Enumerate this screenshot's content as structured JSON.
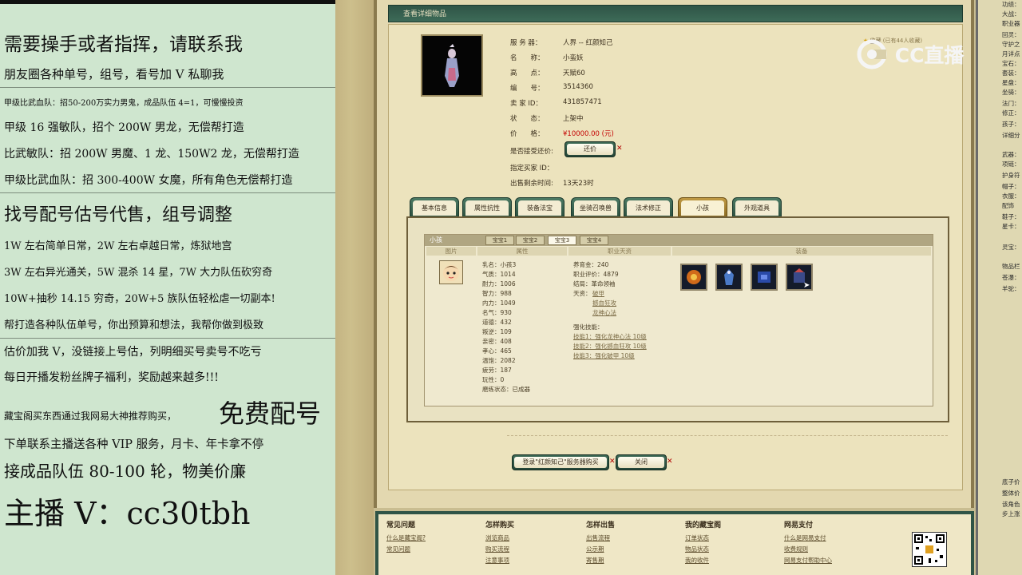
{
  "left_panel": {
    "lines": [
      "需要操手或者指挥，请联系我",
      "朋友圈各种单号，组号，看号加 V 私聊我",
      "甲级比武血队：招50-200万实力男鬼，成品队伍 4=1，可慢慢投资",
      "甲级 16 强敏队，招个 200W 男龙，无偿帮打造",
      "比武敏队：招 200W 男魔、1 龙、150W2 龙，无偿帮打造",
      "甲级比武血队：招 300-400W 女魔，所有角色无偿帮打造",
      "找号配号估号代售，组号调整",
      "1W 左右简单日常，2W 左右卓越日常，炼狱地宫",
      "3W 左右异光通关，5W 混杀 14 星，7W 大力队伍砍穷奇",
      "10W+抽秒 14.15 穷奇，20W+5 族队伍轻松虐一切副本!",
      "帮打造各种队伍单号，你出预算和想法，我帮你做到极致",
      "估价加我 V，没链接上号估，列明细买号卖号不吃亏",
      "每日开播发粉丝牌子福利，奖励越来越多!!!",
      "藏宝阁买东西通过我网易大神推荐购买，",
      "免费配号",
      "下单联系主播送各种 VIP 服务，月卡、年卡拿不停",
      "接成品队伍 80-100 轮，物美价廉",
      "主播 V：cc30tbh"
    ]
  },
  "window": {
    "title": "查看详细物品",
    "fields": [
      {
        "label": "服 务 器：",
        "value": "人界 -- 红颜知己"
      },
      {
        "label": "名　　称：",
        "value": "小蛮妖"
      },
      {
        "label": "高　　点：",
        "value": "天赋60"
      },
      {
        "label": "编　　号：",
        "value": "3514360"
      },
      {
        "label": "卖 家 ID：",
        "value": "431857471"
      },
      {
        "label": "状　　态：",
        "value": "上架中"
      },
      {
        "label": "价　　格：",
        "value": "¥10000.00 (元)"
      }
    ],
    "bargain_label": "是否接受还价:",
    "bargain_button": "还价",
    "buyer_id_label": "指定买家 ID：",
    "remaining_label": "出售剩余时间:",
    "remaining_value": "13天23时",
    "fav_hint": "(已有44人收藏)",
    "fav_label": "收藏",
    "tabs": [
      "基本信息",
      "属性抗性",
      "装备法宝",
      "坐骑召唤兽",
      "法术修正",
      "小孩",
      "外观道具"
    ],
    "active_tab": "小孩",
    "child_panel": {
      "title": "小孩",
      "subtabs": [
        "宝宝1",
        "宝宝2",
        "宝宝3",
        "宝宝4"
      ],
      "active_subtab": "宝宝3",
      "col_headers": [
        "图片",
        "属性",
        "职业天资",
        "装备"
      ],
      "stats": [
        "乳名：小孩3",
        "气质：1014",
        "耐力：1006",
        "智力：988",
        "内力：1049",
        "名气：930",
        "道德：432",
        "叛逆：109",
        "亲密：408",
        "孝心：465",
        "温饱：2082",
        "疲劳：187",
        "玩性：0",
        "磨练状态：已成器"
      ],
      "nurture_label": "养育金：240",
      "career_eval_label": "职业评价：4879",
      "ending_label": "结局：",
      "ending_value": "革命领袖",
      "talent_label": "天资：",
      "talents": [
        "破甲",
        "撼血狂攻",
        "龙神心法"
      ],
      "skills_label": "强化技能：",
      "skills": [
        "技能1：强化龙神心法 10级",
        "技能2：强化撼血狂攻 10级",
        "技能3：强化破甲 10级"
      ]
    },
    "buy_button": "登录\"红颜知己\"服务器购买",
    "close_button": "关闭"
  },
  "footer": {
    "columns": [
      {
        "heading": "常见问题",
        "items": [
          "什么是藏宝阁?",
          "常见问题"
        ]
      },
      {
        "heading": "怎样购买",
        "items": [
          "浏览商品",
          "购买流程",
          "注意事项"
        ]
      },
      {
        "heading": "怎样出售",
        "items": [
          "出售流程",
          "公示期",
          "寄售期"
        ]
      },
      {
        "heading": "我的藏宝阁",
        "items": [
          "订单状态",
          "物品状态",
          "我的收件"
        ]
      },
      {
        "heading": "网易支付",
        "items": [
          "什么是网易支付",
          "收费规则",
          "网易支付帮助中心"
        ]
      }
    ]
  },
  "stream_logo": "CC直播",
  "right_strip": {
    "items": [
      "功绩：",
      "大战：",
      "职业器",
      "回灵：",
      "守护之",
      "月详点",
      "宝石：",
      "套装：",
      "星盘：",
      "坐骑：",
      "法门：",
      "修正：",
      "孩子：",
      "详细分",
      "武器：",
      "项链：",
      "护身符",
      "帽子：",
      "衣服：",
      "配饰",
      "鞋子：",
      "星卡：",
      "灵宝：",
      "物品栏",
      "苍瀑：",
      "羊驼：",
      "底子价",
      "整体价",
      "该角色",
      "步上涨"
    ]
  }
}
